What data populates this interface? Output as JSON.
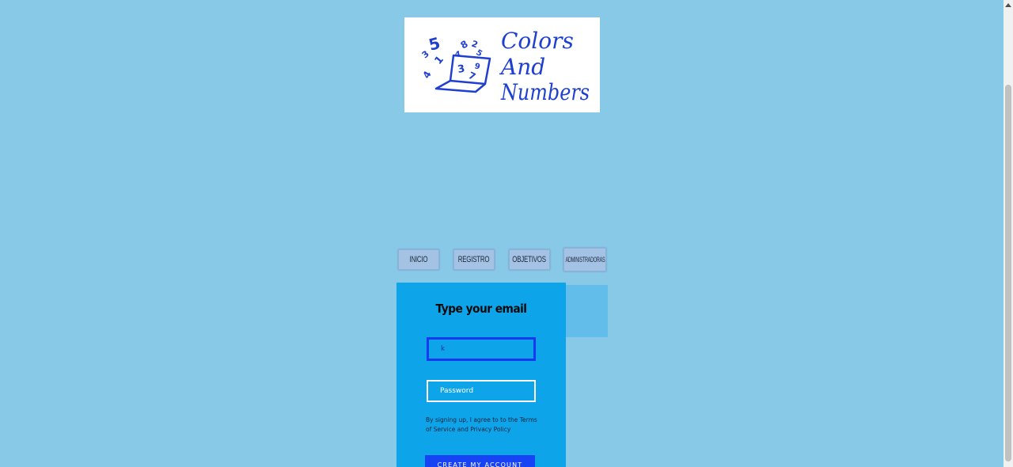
{
  "logo": {
    "line1": "Colors",
    "line2": "And",
    "line3": "Numbers",
    "numbers": [
      "5",
      "2",
      "8",
      "3",
      "1",
      "4",
      "3",
      "9",
      "7",
      "4",
      "5"
    ],
    "color": "#1f3fd0"
  },
  "nav": {
    "inicio": "INICIO",
    "registro": "REGISTRO",
    "objetivos": "OBJETIVOS",
    "administradoras": "ADMINISTRADORAS"
  },
  "form": {
    "title": "Type your email",
    "email_value": "k",
    "password_placeholder": "Password",
    "terms": "By signing up, I agree to to the Terms of Service and Privacy Policy",
    "submit_label": "CREATE MY ACCOUNT"
  },
  "colors": {
    "page_background": "#89c9e8",
    "panel_background": "#0ea4ea",
    "accent_blue": "#1743f5",
    "nav_button": "#a4c2e4"
  },
  "icons": {
    "scroll_up": "scroll-up-arrow-icon"
  }
}
